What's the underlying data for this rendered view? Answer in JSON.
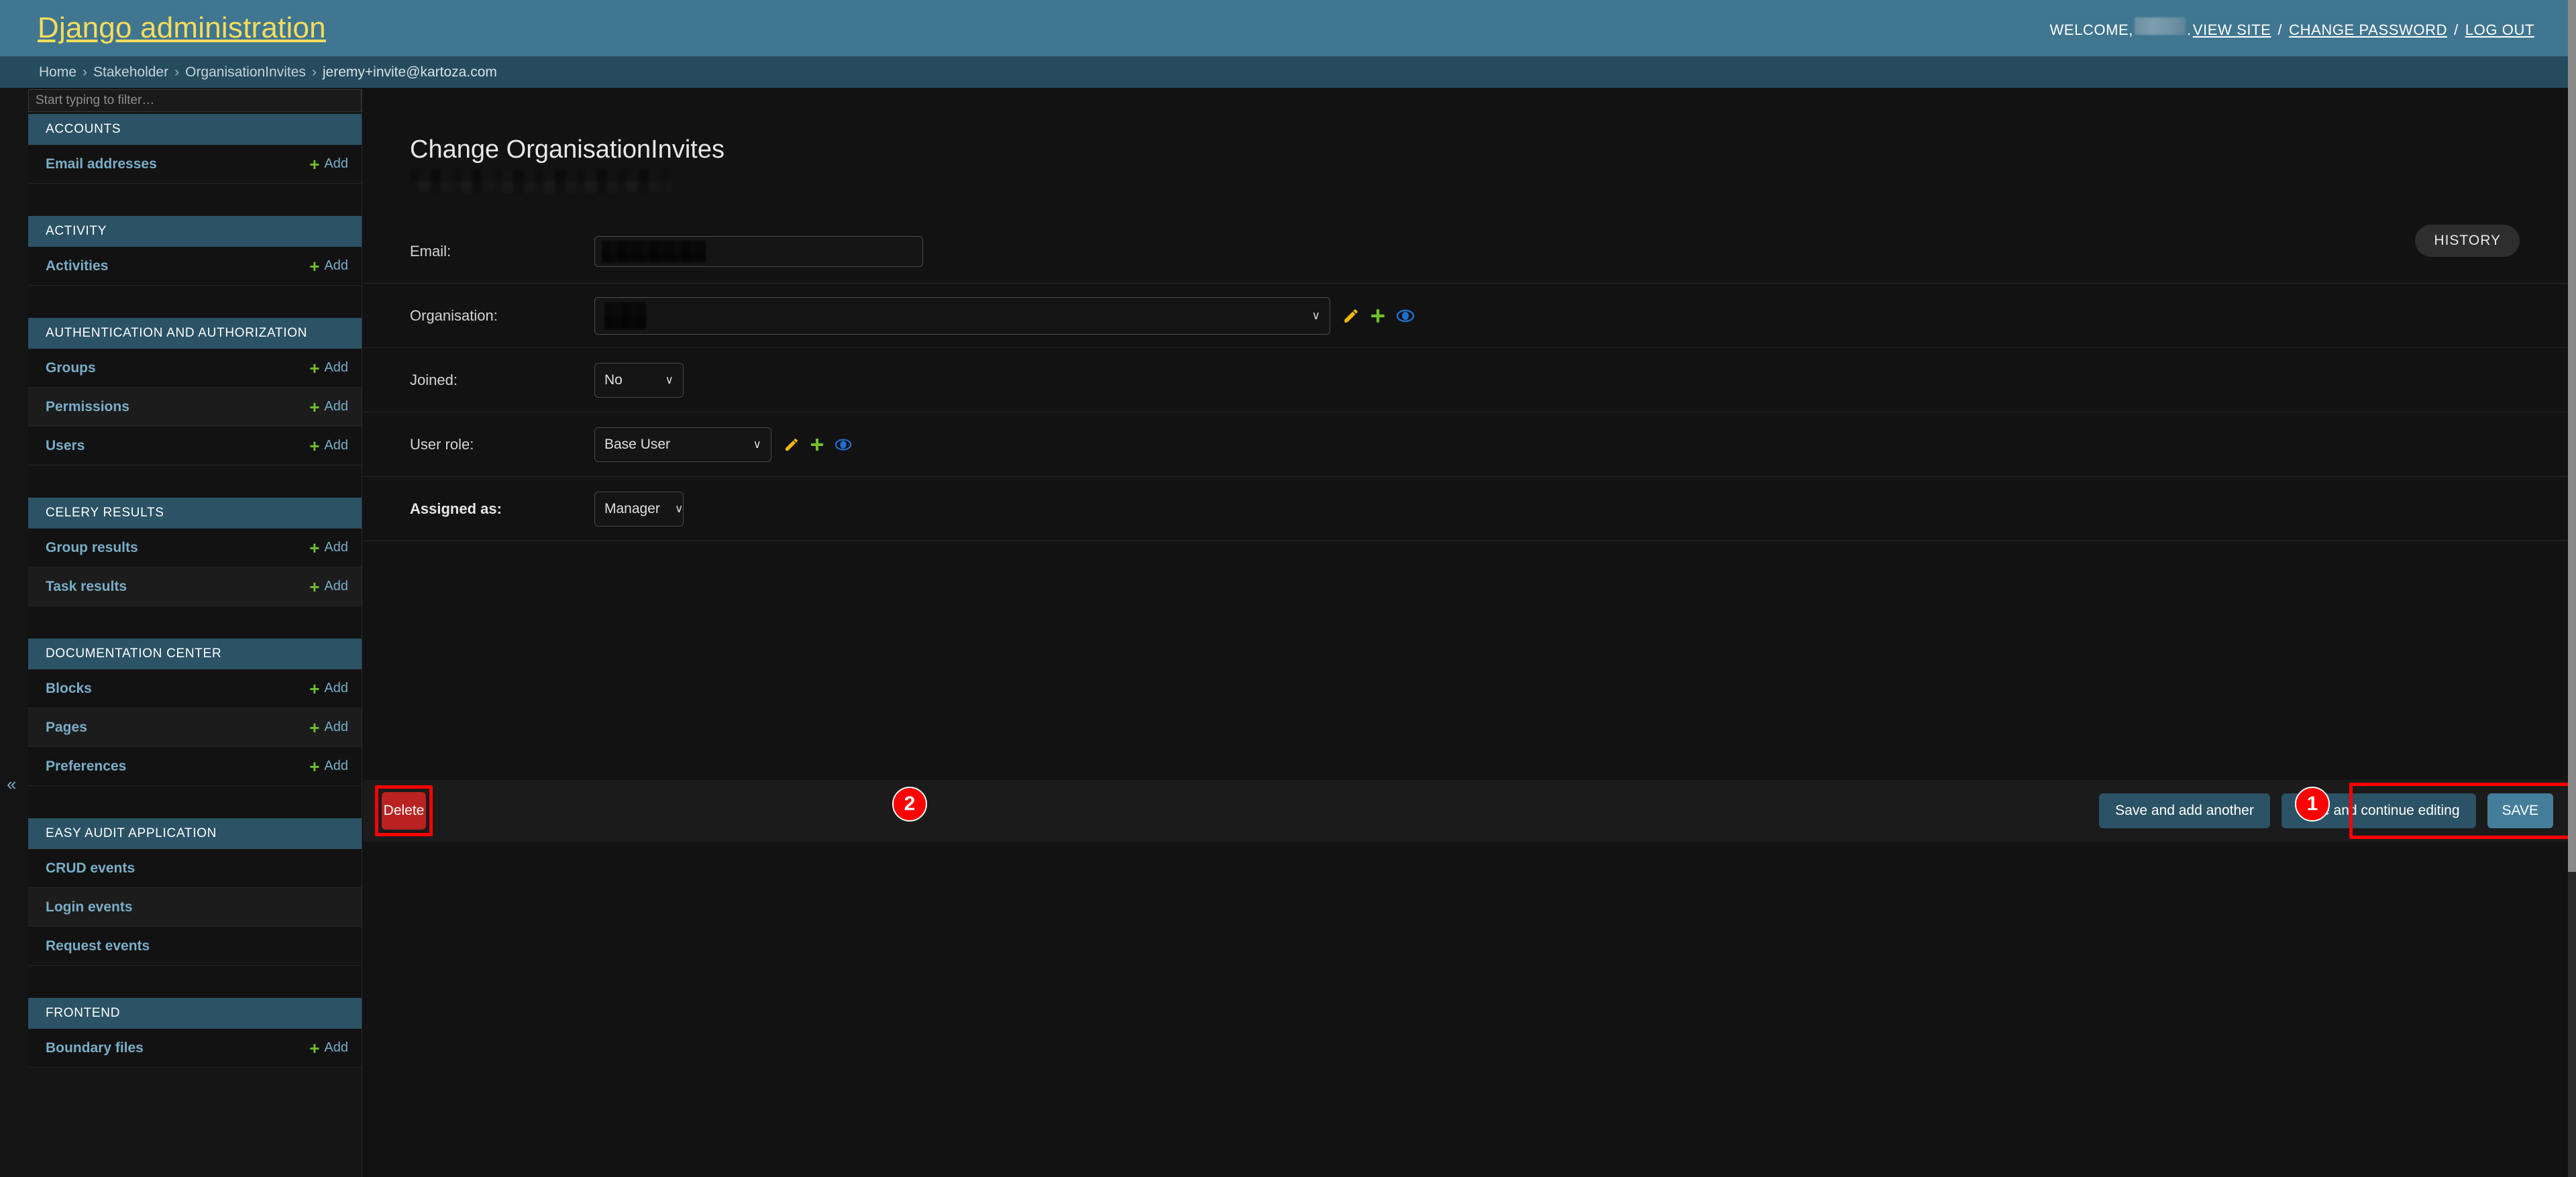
{
  "header": {
    "branding_title": "Django administration",
    "welcome_label": "WELCOME,",
    "username_redacted": true,
    "username_suffix": ".",
    "links": [
      {
        "label": "VIEW SITE"
      },
      {
        "label": "CHANGE PASSWORD"
      },
      {
        "label": "LOG OUT"
      }
    ],
    "separator": "/"
  },
  "breadcrumbs": {
    "items": [
      {
        "label": "Home"
      },
      {
        "label": "Stakeholder"
      },
      {
        "label": "OrganisationInvites"
      },
      {
        "label": "jeremy+invite@kartoza.com"
      }
    ],
    "separator": "›"
  },
  "sidebar": {
    "filter_placeholder": "Start typing to filter…",
    "filter_value": "",
    "collapse_icon": "«",
    "add_label": "Add",
    "apps": [
      {
        "title": "ACCOUNTS",
        "models": [
          {
            "name": "Email addresses",
            "add": true
          }
        ]
      },
      {
        "title": "ACTIVITY",
        "models": [
          {
            "name": "Activities",
            "add": true
          }
        ]
      },
      {
        "title": "AUTHENTICATION AND AUTHORIZATION",
        "models": [
          {
            "name": "Groups",
            "add": true
          },
          {
            "name": "Permissions",
            "add": true
          },
          {
            "name": "Users",
            "add": true
          }
        ]
      },
      {
        "title": "CELERY RESULTS",
        "models": [
          {
            "name": "Group results",
            "add": true
          },
          {
            "name": "Task results",
            "add": true
          }
        ]
      },
      {
        "title": "DOCUMENTATION CENTER",
        "models": [
          {
            "name": "Blocks",
            "add": true
          },
          {
            "name": "Pages",
            "add": true
          },
          {
            "name": "Preferences",
            "add": true
          }
        ]
      },
      {
        "title": "EASY AUDIT APPLICATION",
        "models": [
          {
            "name": "CRUD events",
            "add": false
          },
          {
            "name": "Login events",
            "add": false
          },
          {
            "name": "Request events",
            "add": false
          }
        ]
      },
      {
        "title": "FRONTEND",
        "models": [
          {
            "name": "Boundary files",
            "add": true
          }
        ]
      }
    ]
  },
  "main": {
    "page_title": "Change OrganisationInvites",
    "history_label": "HISTORY",
    "object_name_redacted": true,
    "fields": [
      {
        "label": "Email:",
        "type": "text",
        "value_redacted": true,
        "required": false,
        "related_icons": []
      },
      {
        "label": "Organisation:",
        "type": "select",
        "value_redacted": true,
        "required": false,
        "related_icons": [
          "pencil-icon",
          "plus-icon",
          "eye-icon"
        ]
      },
      {
        "label": "Joined:",
        "type": "select",
        "value": "No",
        "required": false,
        "related_icons": []
      },
      {
        "label": "User role:",
        "type": "select",
        "value": "Base User",
        "required": false,
        "related_icons": [
          "pencil-icon",
          "plus-icon",
          "eye-icon"
        ]
      },
      {
        "label": "Assigned as:",
        "type": "select",
        "value": "Manager",
        "required": true,
        "related_icons": []
      }
    ],
    "select_caret": "∨",
    "submit_row": {
      "delete_label": "Delete",
      "save_and_add_another_label": "Save and add another",
      "save_and_continue_label": "Save and continue editing",
      "save_label": "SAVE"
    }
  },
  "annotations": [
    {
      "number": "1",
      "target": "save-buttons-group"
    },
    {
      "number": "2",
      "target": "delete-button"
    }
  ],
  "colors": {
    "header_bg": "#417690",
    "breadcrumb_bg": "#264b5d",
    "brand_text": "#f5dd5d",
    "link_blue": "#79aec8",
    "app_header_bg": "#2b5265",
    "delete_red": "#ba2121",
    "save_primary": "#447e9b",
    "annotation_red": "#ff0000",
    "add_green": "#70bf2b",
    "pencil_yellow": "#efb80b",
    "eye_blue": "#1f6fd0"
  }
}
